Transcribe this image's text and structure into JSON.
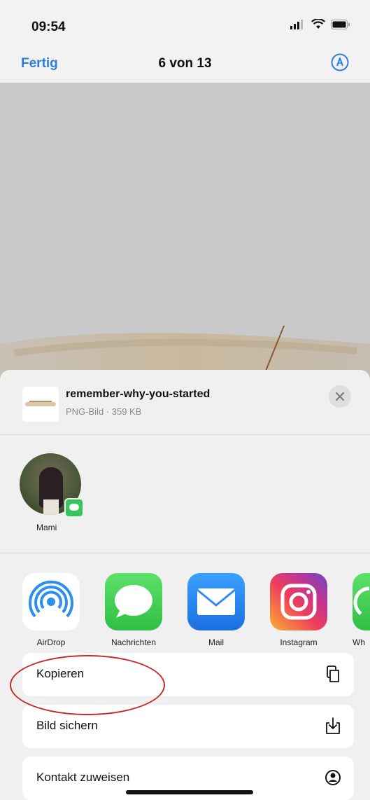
{
  "status_bar": {
    "time": "09:54"
  },
  "nav": {
    "done_label": "Fertig",
    "title": "6 von 13"
  },
  "share_sheet": {
    "file": {
      "name": "remember-why-you-started",
      "meta": "PNG-Bild · 359 KB"
    },
    "contacts": [
      {
        "name": "Mami"
      }
    ],
    "apps": [
      {
        "label": "AirDrop",
        "icon": "airdrop-icon"
      },
      {
        "label": "Nachrichten",
        "icon": "messages-icon"
      },
      {
        "label": "Mail",
        "icon": "mail-icon"
      },
      {
        "label": "Instagram",
        "icon": "instagram-icon"
      },
      {
        "label": "Wh",
        "icon": "whatsapp-icon"
      }
    ],
    "actions": [
      {
        "label": "Kopieren",
        "icon": "copy-icon"
      },
      {
        "label": "Bild sichern",
        "icon": "save-image-icon"
      },
      {
        "label": "Kontakt zuweisen",
        "icon": "contact-icon"
      }
    ]
  },
  "colors": {
    "accent": "#2c7fe0",
    "annotation": "#c8282c",
    "messages": "#34c759",
    "mail": "#2f8cf2"
  }
}
